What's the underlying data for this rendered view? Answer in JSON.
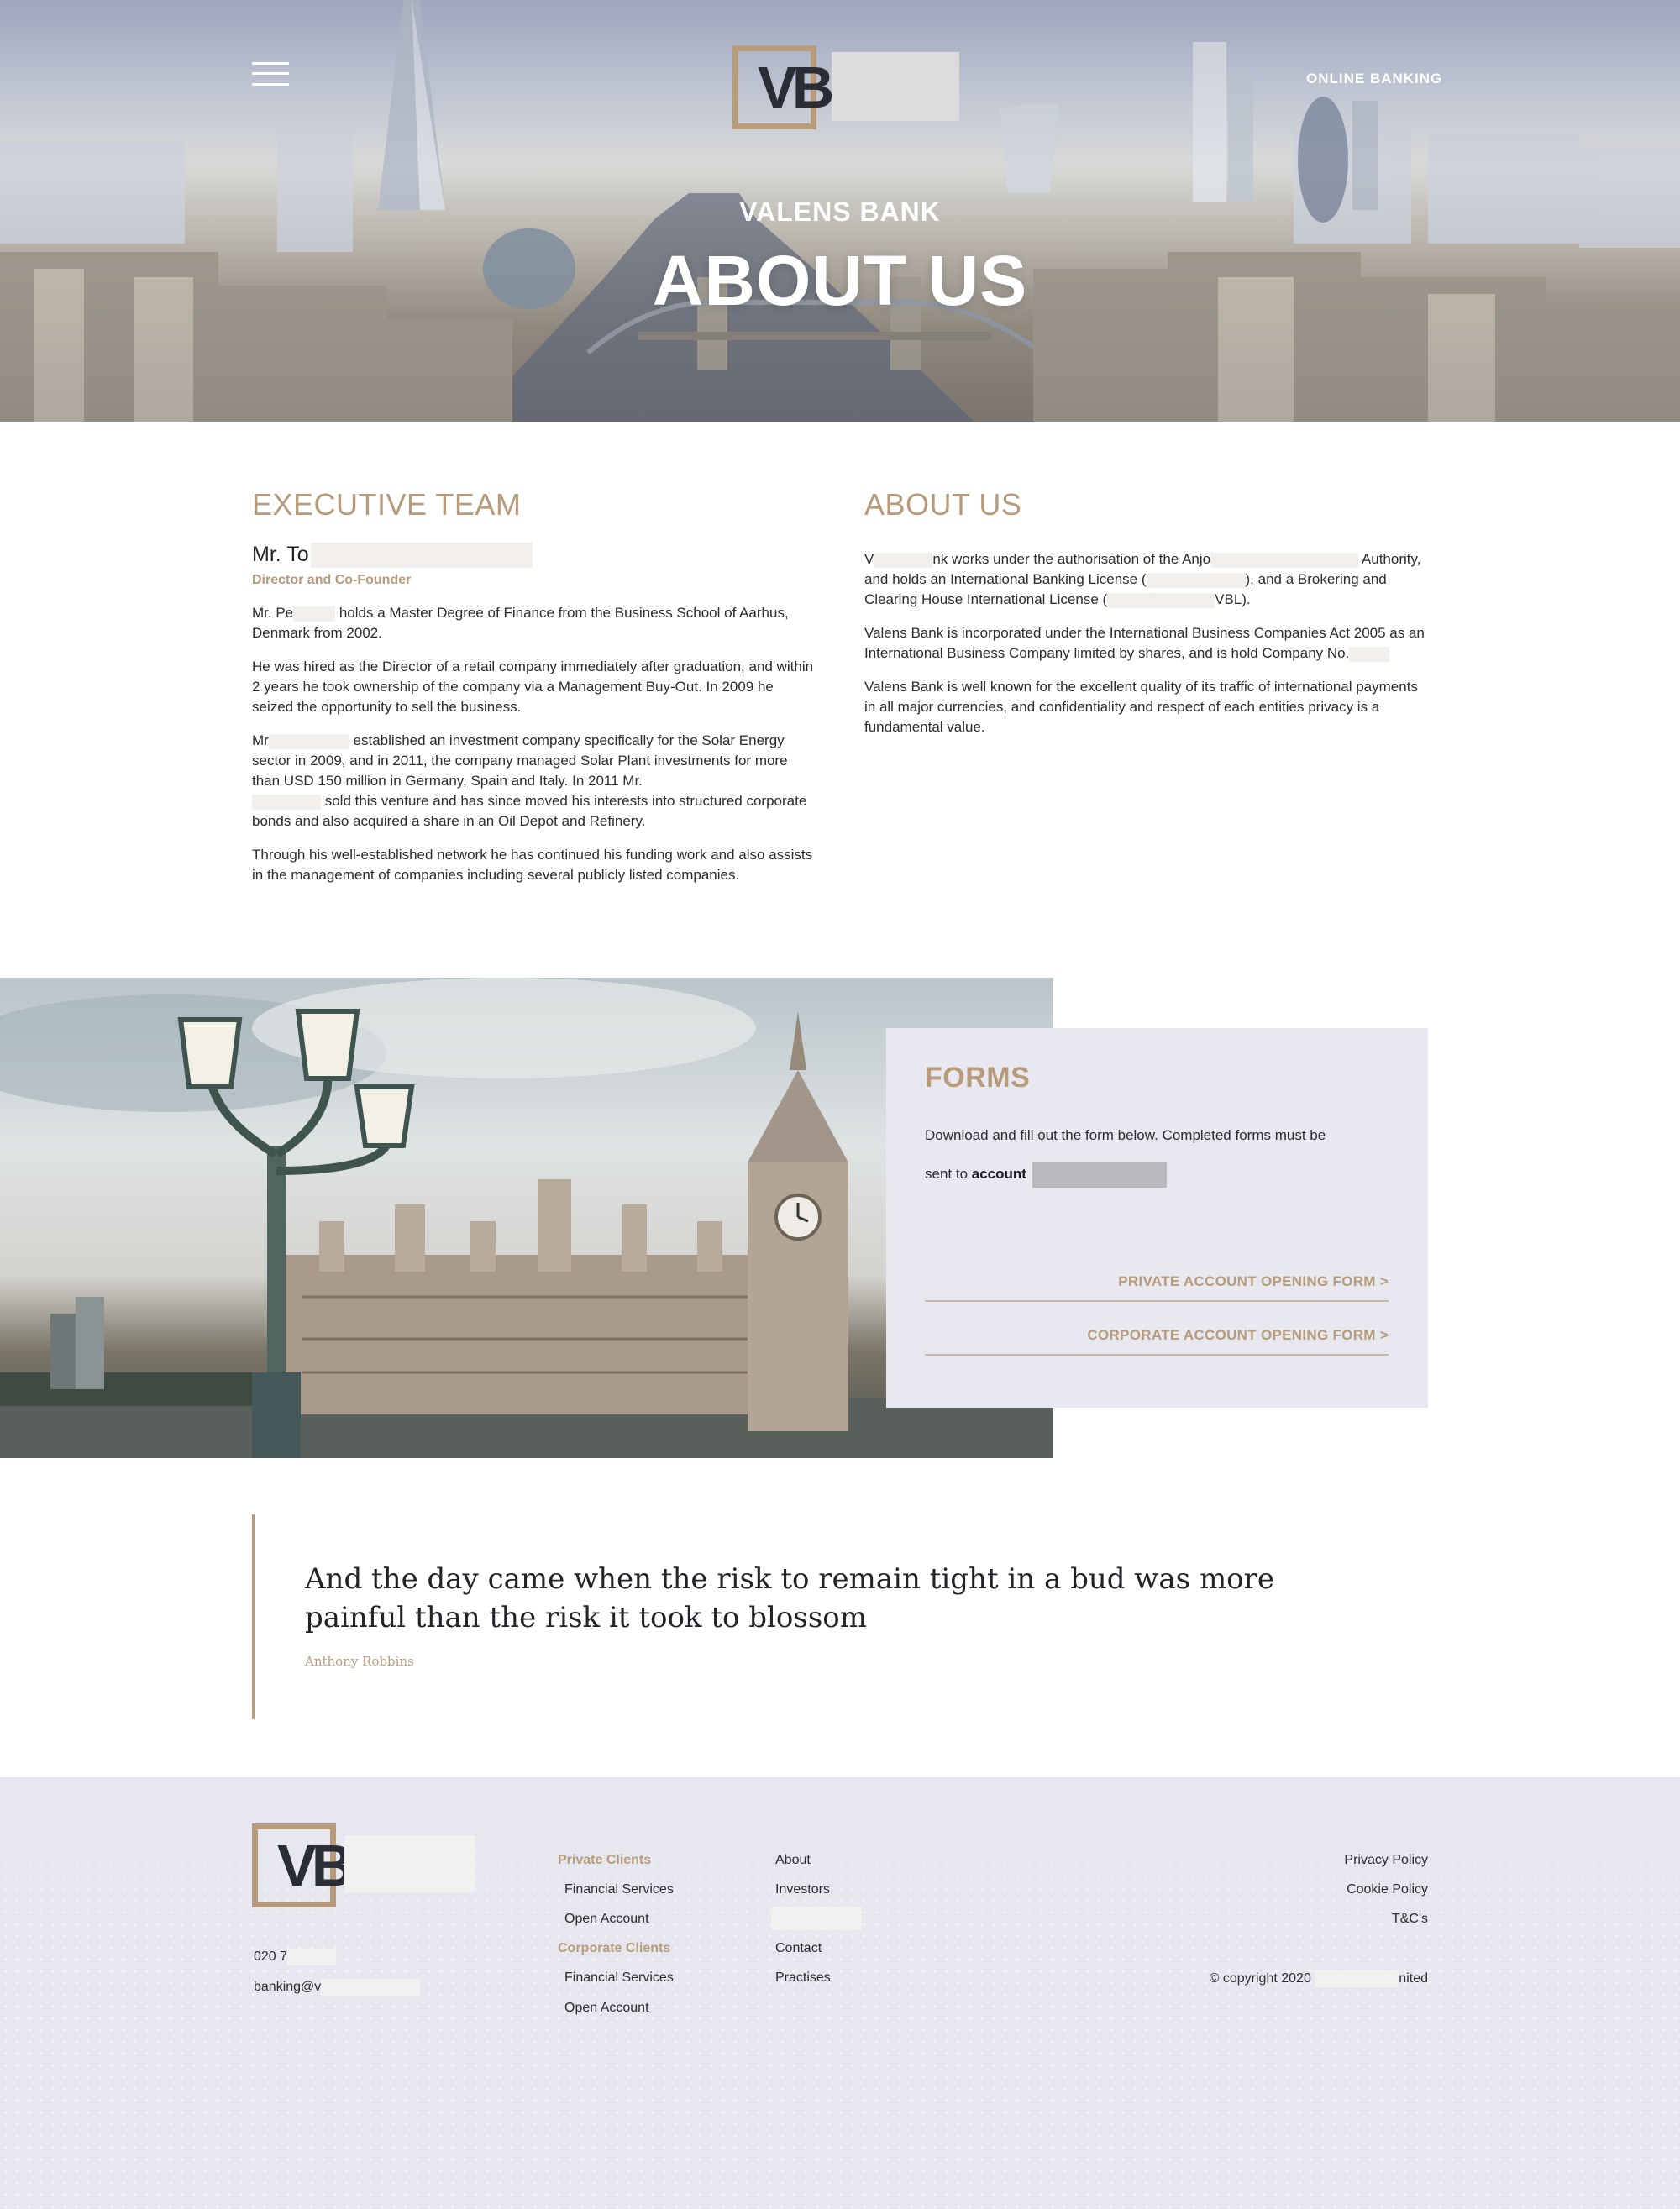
{
  "header": {
    "menu_icon": "hamburger-menu-icon",
    "logo_text": "VB",
    "online_banking": "ONLINE BANKING"
  },
  "hero": {
    "subtitle": "VALENS BANK",
    "title": "ABOUT US"
  },
  "executive": {
    "title": "EXECUTIVE TEAM",
    "name_prefix": "Mr. To",
    "role": "Director and Co-Founder",
    "p1_a": "Mr. Pe",
    "p1_b": " holds a Master Degree of Finance from the Business School of Aarhus, Denmark from 2002.",
    "p2": "He was hired as the Director of a retail company immediately after graduation, and within 2 years he took ownership of the company via a Management Buy-Out. In 2009 he seized the opportunity to sell the business.",
    "p3_a": "Mr",
    "p3_b": " established an investment company specifically for the Solar Energy sector in 2009, and in 2011, the company managed Solar Plant investments for more than USD 150 million in Germany, Spain and Italy. In 2011 Mr.",
    "p3_c": " sold this venture and has since moved his interests into structured corporate bonds and also acquired a share in an Oil Depot and Refinery.",
    "p4": "Through his well-established network he has continued his funding work and also assists in the management of companies including several publicly listed companies."
  },
  "about": {
    "title": "ABOUT US",
    "p1_a": "V",
    "p1_b": "nk works under the authorisation of the Anjo",
    "p1_c": "Authority, and holds an International Banking License (",
    "p1_d": "), and a Brokering and Clearing House International License (",
    "p1_e": "VBL).",
    "p2_a": "Valens Bank is incorporated under the International Business Companies Act 2005 as an International Business Company limited by shares, and is hold Company No.",
    "p3": "Valens Bank is well known for the excellent quality of its traffic of international payments in all major currencies, and confidentiality and respect of each entities privacy is a fundamental value."
  },
  "forms": {
    "title": "FORMS",
    "description": "Download and fill out the form below. Completed forms must be",
    "sent_to": "sent to ",
    "email_prefix": "account",
    "private_link": "PRIVATE ACCOUNT OPENING FORM >",
    "corporate_link": "CORPORATE ACCOUNT OPENING FORM >"
  },
  "quote": {
    "text": "And the day came when the risk to remain tight in a bud was more painful than the risk it took to blossom",
    "author": "Anthony Robbins"
  },
  "footer": {
    "logo_text": "VB",
    "phone_prefix": "020 7",
    "email_prefix": "banking@v",
    "private_clients": "Private Clients",
    "private_financial": "Financial Services",
    "private_open": "Open Account",
    "corporate_clients": "Corporate Clients",
    "corporate_financial": "Financial Services",
    "corporate_open": "Open Account",
    "about": "About",
    "investors": "Investors",
    "contact": "Contact",
    "practises": "Practises",
    "privacy": "Privacy Policy",
    "cookie": "Cookie Policy",
    "tc": "T&C's",
    "copyright_a": "© copyright 2020",
    "copyright_b": "nited"
  }
}
